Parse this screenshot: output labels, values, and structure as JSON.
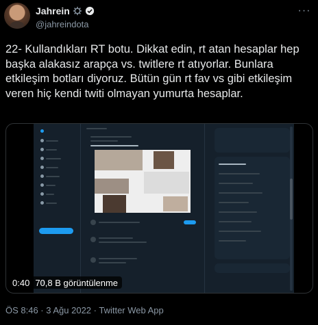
{
  "author": {
    "name": "Jahrein",
    "handle": "@jahreindota"
  },
  "tweet": {
    "text": "22- Kullandıkları RT botu. Dikkat edin, rt atan hesaplar hep başka alakasız arapça vs. twitlere rt atıyorlar. Bunlara etkileşim botları diyoruz. Bütün gün rt fav vs gibi etkileşim veren hiç kendi twiti olmayan yumurta hesaplar."
  },
  "video": {
    "time": "0:40",
    "views": "70,8 B görüntülenme"
  },
  "footer": {
    "timestamp": "ÖS 8:46 · 3 Ağu 2022 · Twitter Web App"
  },
  "colors": {
    "background": "#000000",
    "text": "#e7e9ea",
    "secondary": "#8b98a5",
    "verified": "#1d9bf0",
    "embedded_bg": "#15202b"
  },
  "icons": {
    "verified": "verified-badge-icon",
    "settings": "settings-gear-icon",
    "more": "more-options-icon"
  }
}
